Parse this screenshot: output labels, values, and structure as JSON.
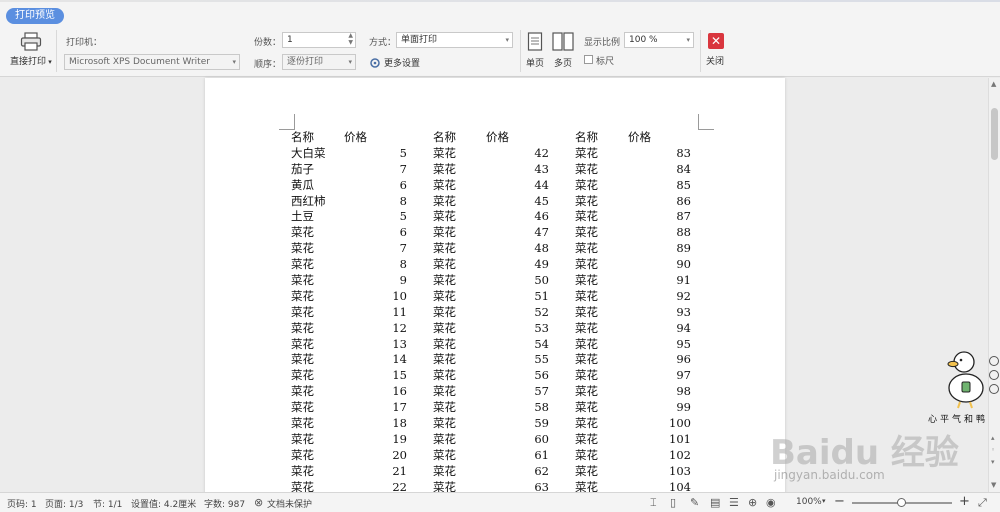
{
  "tab": {
    "label": "打印预览"
  },
  "toolbar": {
    "direct_print_label": "直接打印",
    "printer_label": "打印机：",
    "printer_value": "Microsoft XPS Document Writer",
    "copies_label": "份数：",
    "copies_value": "1",
    "order_label": "顺序：",
    "order_value": "逐份打印",
    "mode_label": "方式：",
    "mode_value": "单面打印",
    "more_settings_label": "更多设置",
    "single_page_label": "单页",
    "multi_page_label": "多页",
    "zoom_label": "显示比例",
    "zoom_value": "100 %",
    "ruler_label": "标尺",
    "close_label": "关闭",
    "close_color": "#d9363e"
  },
  "table": {
    "header": {
      "name": "名称",
      "price": "价格"
    },
    "columns": [
      [
        [
          "大白菜",
          "5"
        ],
        [
          "茄子",
          "7"
        ],
        [
          "黄瓜",
          "6"
        ],
        [
          "西红柿",
          "8"
        ],
        [
          "土豆",
          "5"
        ],
        [
          "菜花",
          "6"
        ],
        [
          "菜花",
          "7"
        ],
        [
          "菜花",
          "8"
        ],
        [
          "菜花",
          "9"
        ],
        [
          "菜花",
          "10"
        ],
        [
          "菜花",
          "11"
        ],
        [
          "菜花",
          "12"
        ],
        [
          "菜花",
          "13"
        ],
        [
          "菜花",
          "14"
        ],
        [
          "菜花",
          "15"
        ],
        [
          "菜花",
          "16"
        ],
        [
          "菜花",
          "17"
        ],
        [
          "菜花",
          "18"
        ],
        [
          "菜花",
          "19"
        ],
        [
          "菜花",
          "20"
        ],
        [
          "菜花",
          "21"
        ],
        [
          "菜花",
          "22"
        ]
      ],
      [
        [
          "菜花",
          "42"
        ],
        [
          "菜花",
          "43"
        ],
        [
          "菜花",
          "44"
        ],
        [
          "菜花",
          "45"
        ],
        [
          "菜花",
          "46"
        ],
        [
          "菜花",
          "47"
        ],
        [
          "菜花",
          "48"
        ],
        [
          "菜花",
          "49"
        ],
        [
          "菜花",
          "50"
        ],
        [
          "菜花",
          "51"
        ],
        [
          "菜花",
          "52"
        ],
        [
          "菜花",
          "53"
        ],
        [
          "菜花",
          "54"
        ],
        [
          "菜花",
          "55"
        ],
        [
          "菜花",
          "56"
        ],
        [
          "菜花",
          "57"
        ],
        [
          "菜花",
          "58"
        ],
        [
          "菜花",
          "59"
        ],
        [
          "菜花",
          "60"
        ],
        [
          "菜花",
          "61"
        ],
        [
          "菜花",
          "62"
        ],
        [
          "菜花",
          "63"
        ]
      ],
      [
        [
          "菜花",
          "83"
        ],
        [
          "菜花",
          "84"
        ],
        [
          "菜花",
          "85"
        ],
        [
          "菜花",
          "86"
        ],
        [
          "菜花",
          "87"
        ],
        [
          "菜花",
          "88"
        ],
        [
          "菜花",
          "89"
        ],
        [
          "菜花",
          "90"
        ],
        [
          "菜花",
          "91"
        ],
        [
          "菜花",
          "92"
        ],
        [
          "菜花",
          "93"
        ],
        [
          "菜花",
          "94"
        ],
        [
          "菜花",
          "95"
        ],
        [
          "菜花",
          "96"
        ],
        [
          "菜花",
          "97"
        ],
        [
          "菜花",
          "98"
        ],
        [
          "菜花",
          "99"
        ],
        [
          "菜花",
          "100"
        ],
        [
          "菜花",
          "101"
        ],
        [
          "菜花",
          "102"
        ],
        [
          "菜花",
          "103"
        ],
        [
          "菜花",
          "104"
        ]
      ]
    ]
  },
  "status": {
    "page_no": "页码: 1",
    "page_count": "页面: 1/3",
    "section": "节: 1/1",
    "setting_value": "设置值: 4.2厘米",
    "word_count": "字数: 987",
    "protection": "文档未保护",
    "zoom": "100%"
  },
  "watermark": {
    "duck_caption": "心平气和鸭",
    "baidu_logo": "Baidu 经验",
    "baidu_url": "jingyan.baidu.com"
  }
}
